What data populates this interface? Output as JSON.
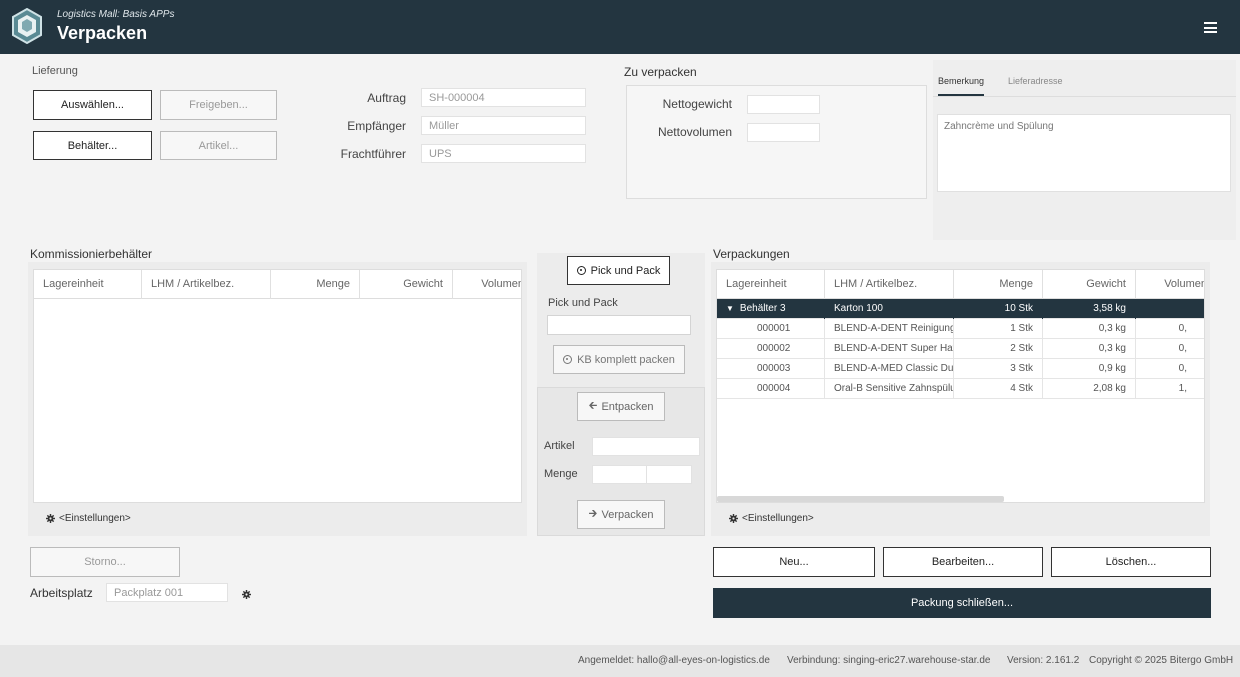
{
  "header": {
    "subtitle": "Logistics Mall: Basis APPs",
    "title": "Verpacken"
  },
  "lieferung": {
    "title": "Lieferung",
    "buttons": {
      "auswaehlen": "Auswählen...",
      "freigeben": "Freigeben...",
      "behaelter": "Behälter...",
      "artikel": "Artikel..."
    },
    "fields": {
      "auftrag_label": "Auftrag",
      "auftrag_value": "SH-000004",
      "empfaenger_label": "Empfänger",
      "empfaenger_value": "Müller",
      "frachtfuehrer_label": "Frachtführer",
      "frachtfuehrer_value": "UPS"
    }
  },
  "zu_verpacken": {
    "title": "Zu verpacken",
    "nettogewicht_label": "Nettogewicht",
    "nettovolumen_label": "Nettovolumen"
  },
  "tabs": {
    "bemerkung": "Bemerkung",
    "lieferadresse": "Lieferadresse",
    "active": "bemerkung",
    "bemerkung_text": "Zahncrème und Spülung"
  },
  "kommissionierbehaelter": {
    "title": "Kommissionierbehälter",
    "columns": [
      "Lagereinheit",
      "LHM / Artikelbez.",
      "Menge",
      "Gewicht",
      "Volumen"
    ],
    "settings_label": "<Einstellungen>"
  },
  "middle": {
    "pick_und_pack_button": "Pick und Pack",
    "pick_und_pack_label": "Pick und Pack",
    "kb_komplett_button": "KB komplett packen",
    "entpacken_button": "Entpacken",
    "artikel_label": "Artikel",
    "menge_label": "Menge",
    "verpacken_button": "Verpacken"
  },
  "verpackungen": {
    "title": "Verpackungen",
    "columns": [
      "Lagereinheit",
      "LHM / Artikelbez.",
      "Menge",
      "Gewicht",
      "Volumen"
    ],
    "rows": [
      {
        "lagereinheit": "Behälter 3",
        "artikel": "Karton 100",
        "menge": "10 Stk",
        "gewicht": "3,58 kg",
        "volumen": ""
      },
      {
        "lagereinheit": "000001",
        "artikel": "BLEND-A-DENT Reinigungs",
        "menge": "1 Stk",
        "gewicht": "0,3 kg",
        "volumen": "0,"
      },
      {
        "lagereinheit": "000002",
        "artikel": "BLEND-A-DENT Super Haftc",
        "menge": "2 Stk",
        "gewicht": "0,3 kg",
        "volumen": "0,"
      },
      {
        "lagereinheit": "000003",
        "artikel": "BLEND-A-MED Classic Duop",
        "menge": "3 Stk",
        "gewicht": "0,9 kg",
        "volumen": "0,"
      },
      {
        "lagereinheit": "000004",
        "artikel": "Oral-B Sensitive Zahnspülun",
        "menge": "4 Stk",
        "gewicht": "2,08 kg",
        "volumen": "1,"
      }
    ],
    "settings_label": "<Einstellungen>",
    "neu_button": "Neu...",
    "bearbeiten_button": "Bearbeiten...",
    "loeschen_button": "Löschen...",
    "packung_schliessen_button": "Packung schließen..."
  },
  "bottom": {
    "storno_button": "Storno...",
    "arbeitsplatz_label": "Arbeitsplatz",
    "arbeitsplatz_value": "Packplatz 001"
  },
  "footer": {
    "angemeldet": "Angemeldet: hallo@all-eyes-on-logistics.de",
    "verbindung": "Verbindung: singing-eric27.warehouse-star.de",
    "version": "Version: 2.161.2",
    "copyright": "Copyright © 2025 Bitergo GmbH"
  },
  "colors": {
    "header_bg": "#233540",
    "selected_row": "#233540"
  }
}
